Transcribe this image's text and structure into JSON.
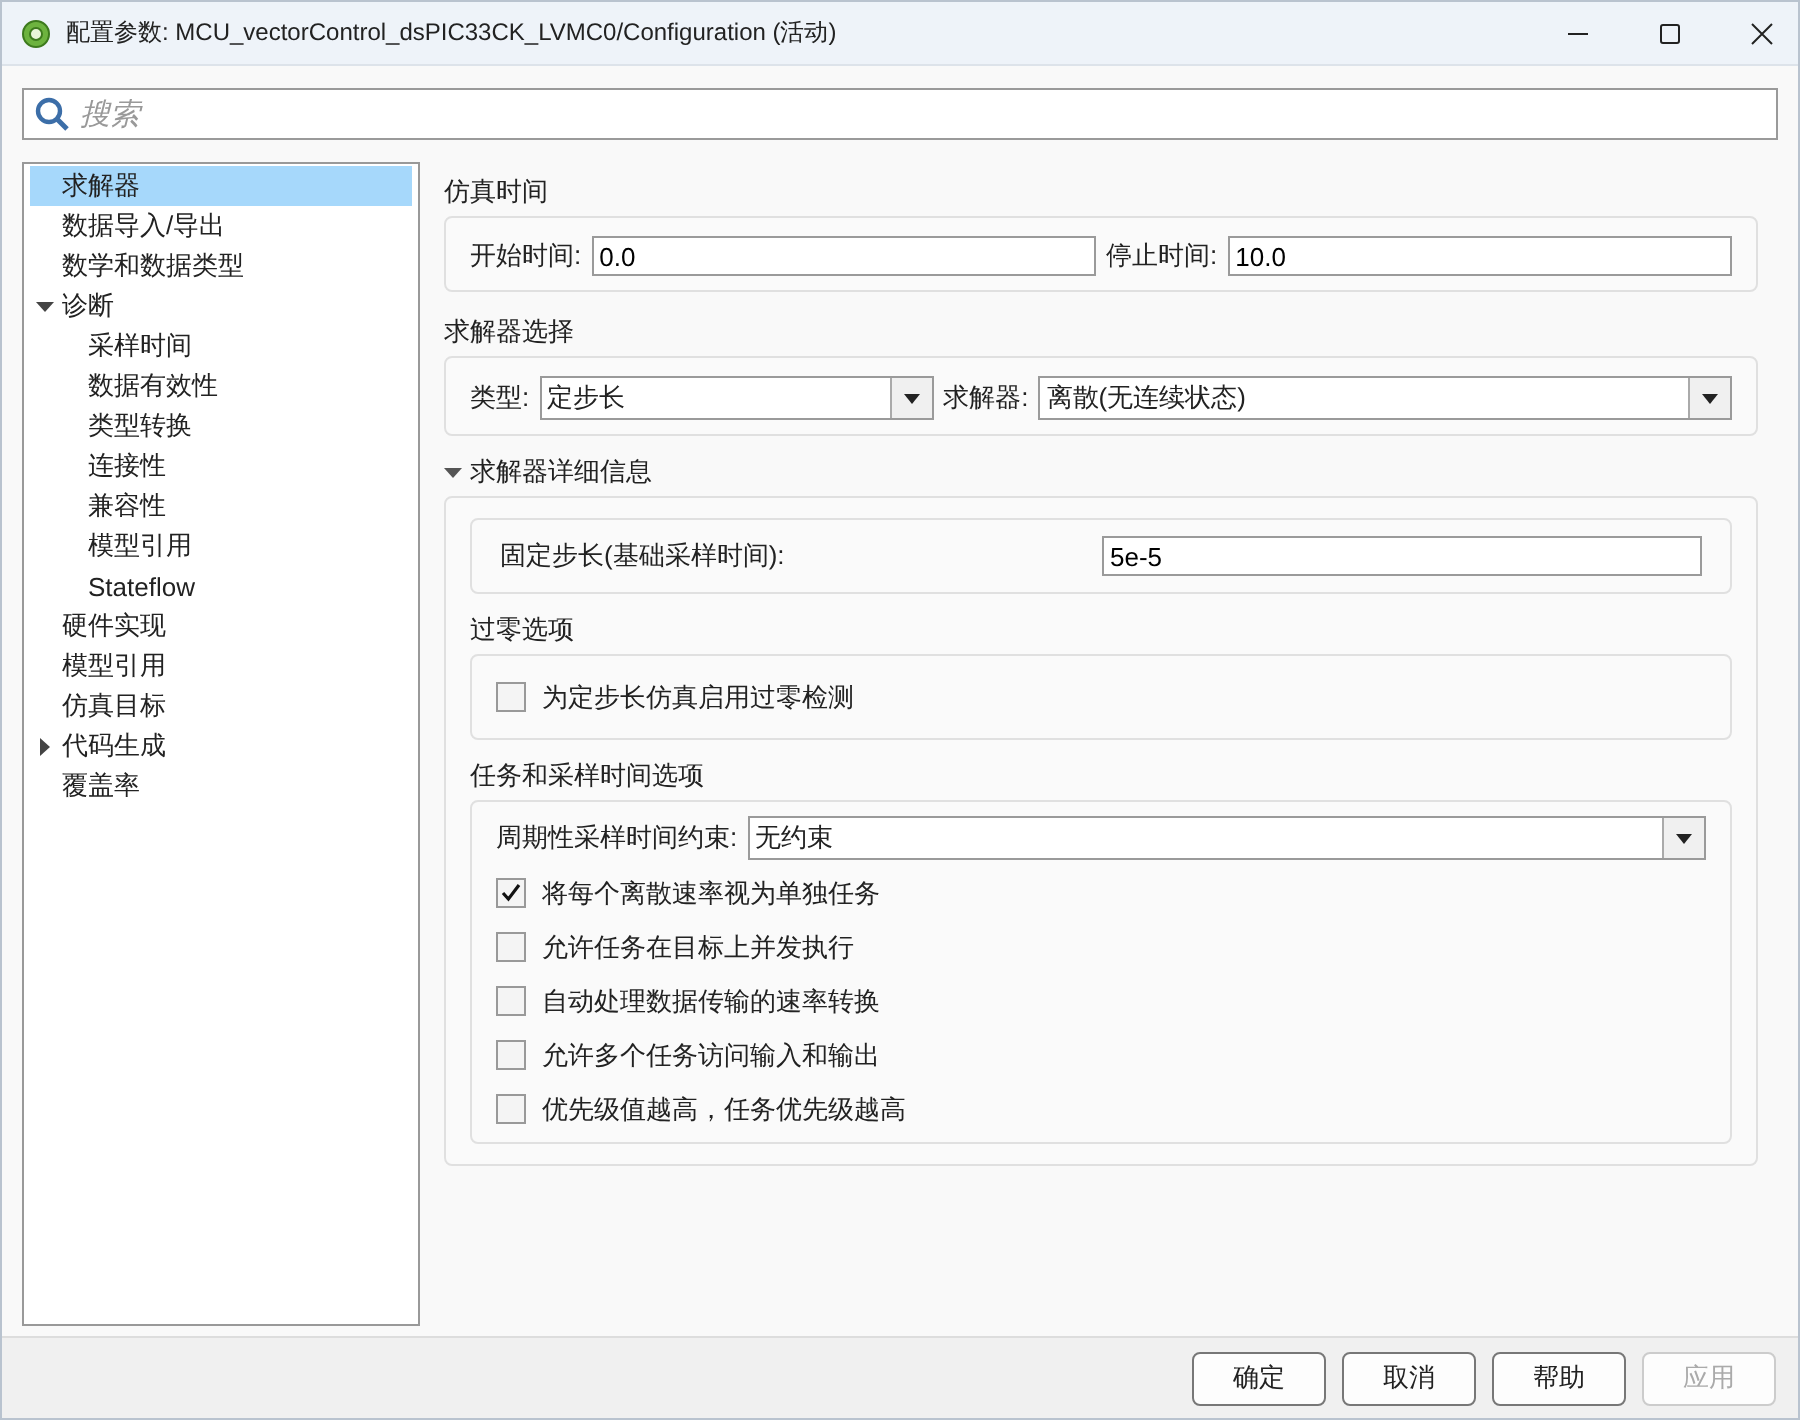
{
  "window": {
    "title": "配置参数: MCU_vectorControl_dsPIC33CK_LVMC0/Configuration (活动)"
  },
  "search": {
    "placeholder": "搜索"
  },
  "tree": [
    {
      "label": "求解器",
      "selected": true
    },
    {
      "label": "数据导入/导出",
      "selected": false
    },
    {
      "label": "数学和数据类型",
      "selected": false
    },
    {
      "label": "诊断",
      "selected": false,
      "expanded": true,
      "children": [
        {
          "label": "采样时间",
          "selected": false
        },
        {
          "label": "数据有效性",
          "selected": false
        },
        {
          "label": "类型转换",
          "selected": false
        },
        {
          "label": "连接性",
          "selected": false
        },
        {
          "label": "兼容性",
          "selected": false
        },
        {
          "label": "模型引用",
          "selected": false
        },
        {
          "label": "Stateflow",
          "selected": false
        }
      ]
    },
    {
      "label": "硬件实现",
      "selected": false
    },
    {
      "label": "模型引用",
      "selected": false
    },
    {
      "label": "仿真目标",
      "selected": false
    },
    {
      "label": "代码生成",
      "selected": false,
      "expanded": false
    },
    {
      "label": "覆盖率",
      "selected": false
    }
  ],
  "simulation_time": {
    "title": "仿真时间",
    "fields": [
      {
        "label": "开始时间:",
        "value": "0.0"
      },
      {
        "label": "停止时间:",
        "value": "10.0"
      }
    ]
  },
  "solver_selection": {
    "title": "求解器选择",
    "dropdowns": [
      {
        "label": "类型:",
        "value": "定步长"
      },
      {
        "label": "求解器:",
        "value": "离散(无连续状态)"
      }
    ]
  },
  "solver_details": {
    "title": "求解器详细信息",
    "expanded": true,
    "fixed_step": {
      "label": "固定步长(基础采样时间):",
      "value": "5e-5"
    },
    "zero_crossing": {
      "title": "过零选项",
      "options": [
        {
          "label": "为定步长仿真启用过零检测",
          "checked": false
        }
      ]
    },
    "tasks": {
      "title": "任务和采样时间选项",
      "constraint": {
        "label": "周期性采样时间约束:",
        "value": "无约束"
      },
      "options": [
        {
          "label": "将每个离散速率视为单独任务",
          "checked": true
        },
        {
          "label": "允许任务在目标上并发执行",
          "checked": false
        },
        {
          "label": "自动处理数据传输的速率转换",
          "checked": false
        },
        {
          "label": "允许多个任务访问输入和输出",
          "checked": false
        },
        {
          "label": "优先级值越高，任务优先级越高",
          "checked": false
        }
      ]
    }
  },
  "buttons": [
    {
      "label": "确定",
      "disabled": false
    },
    {
      "label": "取消",
      "disabled": false
    },
    {
      "label": "帮助",
      "disabled": false
    },
    {
      "label": "应用",
      "disabled": true
    }
  ]
}
